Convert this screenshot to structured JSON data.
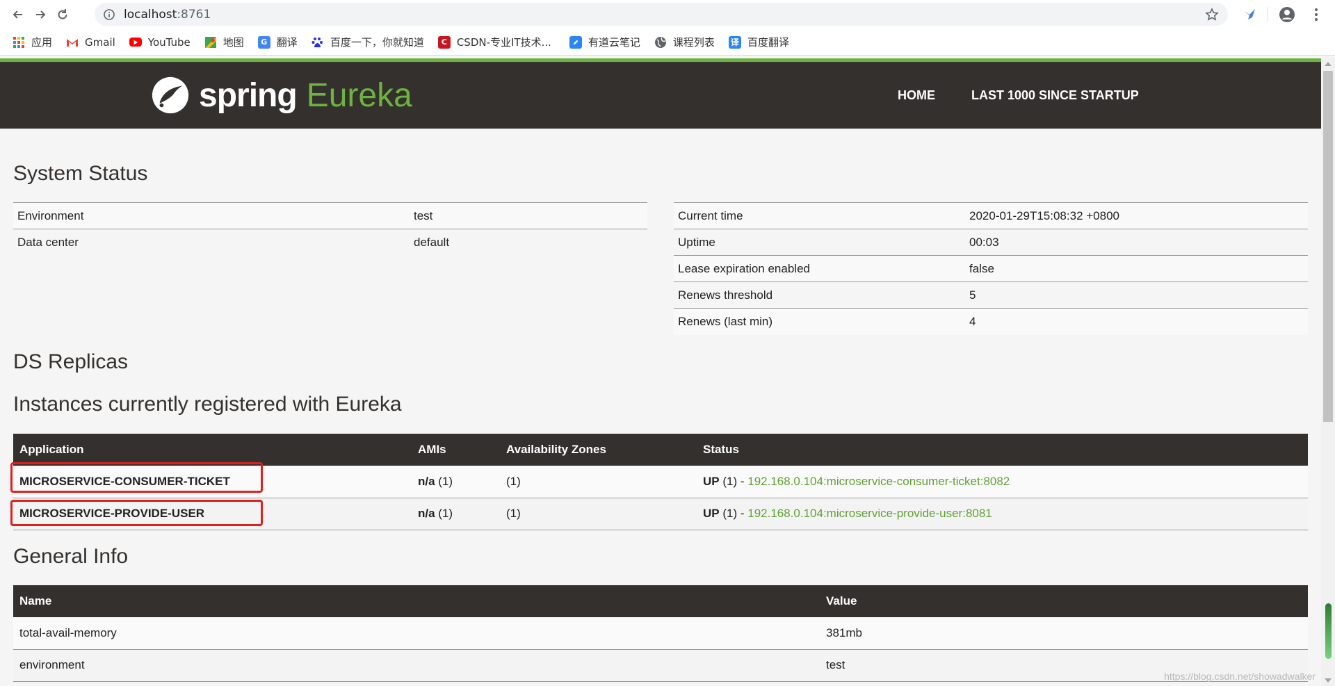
{
  "browser": {
    "url_host": "localhost",
    "url_port": ":8761",
    "bookmarks": [
      {
        "label": "应用",
        "icon": "apps-grid-icon"
      },
      {
        "label": "Gmail",
        "icon": "gmail-icon"
      },
      {
        "label": "YouTube",
        "icon": "youtube-icon"
      },
      {
        "label": "地图",
        "icon": "maps-icon"
      },
      {
        "label": "翻译",
        "icon": "translate-icon"
      },
      {
        "label": "百度一下，你就知道",
        "icon": "baidu-icon"
      },
      {
        "label": "CSDN-专业IT技术...",
        "icon": "csdn-icon"
      },
      {
        "label": "有道云笔记",
        "icon": "youdao-note-icon"
      },
      {
        "label": "课程列表",
        "icon": "globe-icon"
      },
      {
        "label": "百度翻译",
        "icon": "baidu-translate-icon"
      }
    ]
  },
  "header": {
    "logo_spring": "spring",
    "logo_eureka": "Eureka",
    "nav_home": "HOME",
    "nav_last": "LAST 1000 SINCE STARTUP"
  },
  "system_status": {
    "title": "System Status",
    "left": [
      {
        "key": "Environment",
        "value": "test"
      },
      {
        "key": "Data center",
        "value": "default"
      }
    ],
    "right": [
      {
        "key": "Current time",
        "value": "2020-01-29T15:08:32 +0800"
      },
      {
        "key": "Uptime",
        "value": "00:03"
      },
      {
        "key": "Lease expiration enabled",
        "value": "false"
      },
      {
        "key": "Renews threshold",
        "value": "5"
      },
      {
        "key": "Renews (last min)",
        "value": "4"
      }
    ]
  },
  "ds_replicas": {
    "title": "DS Replicas"
  },
  "instances": {
    "title": "Instances currently registered with Eureka",
    "headers": {
      "application": "Application",
      "amis": "AMIs",
      "zones": "Availability Zones",
      "status": "Status"
    },
    "rows": [
      {
        "application": "MICROSERVICE-CONSUMER-TICKET",
        "amis_na": "n/a",
        "amis_count": " (1)",
        "zones": "(1)",
        "status_up": "UP",
        "status_count": " (1) - ",
        "status_link": "192.168.0.104:microservice-consumer-ticket:8082"
      },
      {
        "application": "MICROSERVICE-PROVIDE-USER",
        "amis_na": "n/a",
        "amis_count": " (1)",
        "zones": "(1)",
        "status_up": "UP",
        "status_count": " (1) - ",
        "status_link": "192.168.0.104:microservice-provide-user:8081"
      }
    ]
  },
  "general_info": {
    "title": "General Info",
    "headers": {
      "name": "Name",
      "value": "Value"
    },
    "rows": [
      {
        "name": "total-avail-memory",
        "value": "381mb"
      },
      {
        "name": "environment",
        "value": "test"
      }
    ]
  },
  "watermark": "https://blog.csdn.net/showadwalker",
  "colors": {
    "spring_green": "#6db33f",
    "header_dark": "#34302d",
    "link_green": "#5fa134",
    "highlight_red": "#e0201c"
  }
}
